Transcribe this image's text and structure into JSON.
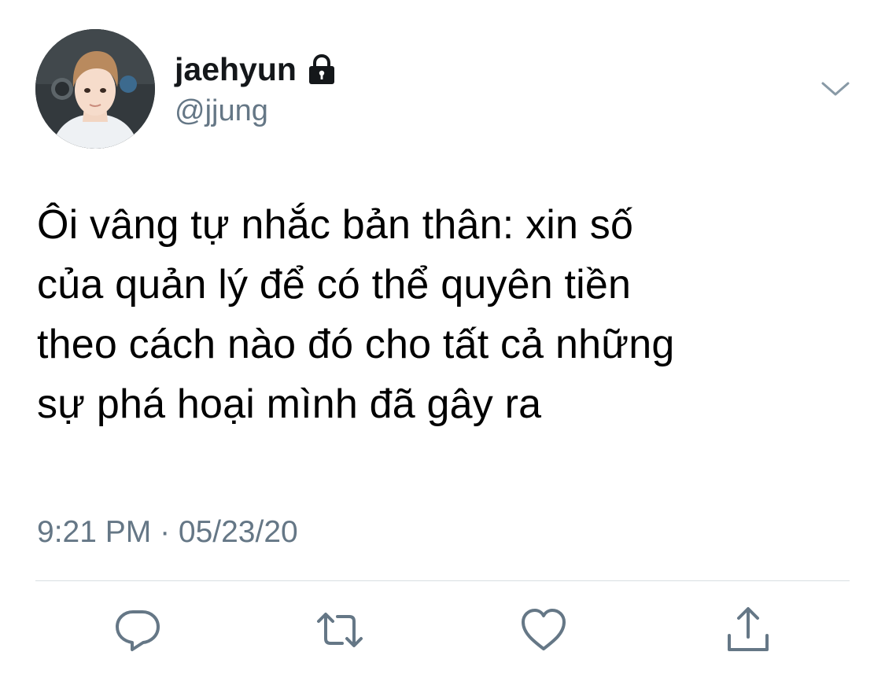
{
  "user": {
    "display_name": "jaehyun",
    "handle": "@jjung",
    "avatar": "profile-photo",
    "protected_icon": "lock-icon"
  },
  "menu": {
    "icon": "chevron-down-icon"
  },
  "tweet": {
    "lines": [
      "Ôi vâng tự nhắc bản thân: xin số",
      "của quản lý để có thể quyên tiền",
      "theo cách nào đó cho tất cả những",
      "sự phá hoại mình đã gây ra"
    ],
    "timestamp": "9:21 PM · 05/23/20"
  },
  "actions": [
    {
      "name": "reply",
      "icon": "speech-bubble-icon"
    },
    {
      "name": "retweet",
      "icon": "retweet-arrows-icon"
    },
    {
      "name": "like",
      "icon": "heart-icon"
    },
    {
      "name": "share",
      "icon": "share-upload-icon"
    }
  ],
  "colors": {
    "text": "#14171a",
    "secondary_text": "#657786",
    "divider": "#d8dee2",
    "icon": "#657786"
  }
}
